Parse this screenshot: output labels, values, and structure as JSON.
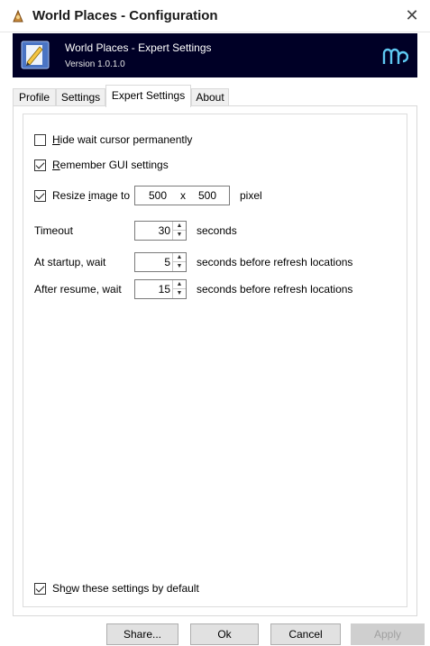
{
  "window": {
    "title": "World Places - Configuration",
    "close_glyph": "✕"
  },
  "banner": {
    "title": "World Places - Expert Settings",
    "version": "Version 1.0.1.0",
    "background": "#000026"
  },
  "tabs": [
    {
      "label": "Profile",
      "active": false
    },
    {
      "label": "Settings",
      "active": false
    },
    {
      "label": "Expert Settings",
      "active": true
    },
    {
      "label": "About",
      "active": false
    }
  ],
  "options": {
    "hide_wait_cursor": {
      "label_u": "H",
      "label_rest": "ide wait cursor permanently",
      "checked": false
    },
    "remember_gui": {
      "label_u": "R",
      "label_rest": "emember GUI settings",
      "checked": true
    },
    "resize_image": {
      "label_pre": "Resize ",
      "label_u": "i",
      "label_rest": "mage to",
      "checked": true,
      "width": "500",
      "x": "x",
      "height": "500",
      "unit": "pixel"
    }
  },
  "timing": {
    "timeout": {
      "label": "Timeout",
      "value": "30",
      "unit": "seconds"
    },
    "startup": {
      "label": "At startup, wait",
      "value": "5",
      "unit": "seconds before refresh locations"
    },
    "resume": {
      "label": "After resume, wait",
      "value": "15",
      "unit": "seconds before refresh locations"
    }
  },
  "show_default": {
    "label_pre": "Sh",
    "label_u": "o",
    "label_rest": "w these settings by default",
    "checked": true
  },
  "buttons": {
    "share": "Share...",
    "ok": "Ok",
    "cancel": "Cancel",
    "apply": "Apply"
  }
}
